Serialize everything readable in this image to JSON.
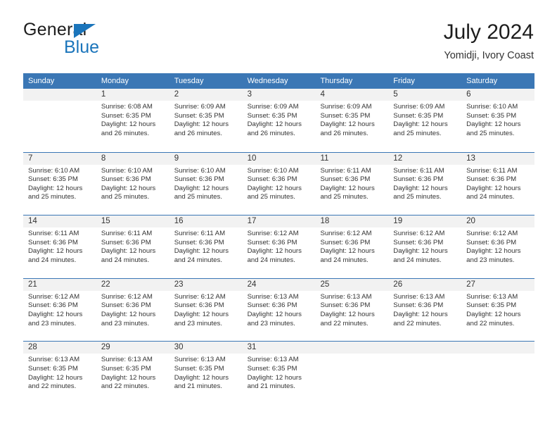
{
  "brand": {
    "word_one": "General",
    "word_two": "Blue",
    "flag_icon": "triangle-flag-icon",
    "accent_color": "#1b75bb"
  },
  "header": {
    "title": "July 2024",
    "subtitle": "Yomidji, Ivory Coast"
  },
  "calendar": {
    "header_color": "#3b77b5",
    "day_band_color": "#f2f2f2",
    "day_names": [
      "Sunday",
      "Monday",
      "Tuesday",
      "Wednesday",
      "Thursday",
      "Friday",
      "Saturday"
    ],
    "weeks": [
      [
        {
          "day": "",
          "lines": []
        },
        {
          "day": "1",
          "lines": [
            "Sunrise: 6:08 AM",
            "Sunset: 6:35 PM",
            "Daylight: 12 hours",
            "and 26 minutes."
          ]
        },
        {
          "day": "2",
          "lines": [
            "Sunrise: 6:09 AM",
            "Sunset: 6:35 PM",
            "Daylight: 12 hours",
            "and 26 minutes."
          ]
        },
        {
          "day": "3",
          "lines": [
            "Sunrise: 6:09 AM",
            "Sunset: 6:35 PM",
            "Daylight: 12 hours",
            "and 26 minutes."
          ]
        },
        {
          "day": "4",
          "lines": [
            "Sunrise: 6:09 AM",
            "Sunset: 6:35 PM",
            "Daylight: 12 hours",
            "and 26 minutes."
          ]
        },
        {
          "day": "5",
          "lines": [
            "Sunrise: 6:09 AM",
            "Sunset: 6:35 PM",
            "Daylight: 12 hours",
            "and 25 minutes."
          ]
        },
        {
          "day": "6",
          "lines": [
            "Sunrise: 6:10 AM",
            "Sunset: 6:35 PM",
            "Daylight: 12 hours",
            "and 25 minutes."
          ]
        }
      ],
      [
        {
          "day": "7",
          "lines": [
            "Sunrise: 6:10 AM",
            "Sunset: 6:35 PM",
            "Daylight: 12 hours",
            "and 25 minutes."
          ]
        },
        {
          "day": "8",
          "lines": [
            "Sunrise: 6:10 AM",
            "Sunset: 6:36 PM",
            "Daylight: 12 hours",
            "and 25 minutes."
          ]
        },
        {
          "day": "9",
          "lines": [
            "Sunrise: 6:10 AM",
            "Sunset: 6:36 PM",
            "Daylight: 12 hours",
            "and 25 minutes."
          ]
        },
        {
          "day": "10",
          "lines": [
            "Sunrise: 6:10 AM",
            "Sunset: 6:36 PM",
            "Daylight: 12 hours",
            "and 25 minutes."
          ]
        },
        {
          "day": "11",
          "lines": [
            "Sunrise: 6:11 AM",
            "Sunset: 6:36 PM",
            "Daylight: 12 hours",
            "and 25 minutes."
          ]
        },
        {
          "day": "12",
          "lines": [
            "Sunrise: 6:11 AM",
            "Sunset: 6:36 PM",
            "Daylight: 12 hours",
            "and 25 minutes."
          ]
        },
        {
          "day": "13",
          "lines": [
            "Sunrise: 6:11 AM",
            "Sunset: 6:36 PM",
            "Daylight: 12 hours",
            "and 24 minutes."
          ]
        }
      ],
      [
        {
          "day": "14",
          "lines": [
            "Sunrise: 6:11 AM",
            "Sunset: 6:36 PM",
            "Daylight: 12 hours",
            "and 24 minutes."
          ]
        },
        {
          "day": "15",
          "lines": [
            "Sunrise: 6:11 AM",
            "Sunset: 6:36 PM",
            "Daylight: 12 hours",
            "and 24 minutes."
          ]
        },
        {
          "day": "16",
          "lines": [
            "Sunrise: 6:11 AM",
            "Sunset: 6:36 PM",
            "Daylight: 12 hours",
            "and 24 minutes."
          ]
        },
        {
          "day": "17",
          "lines": [
            "Sunrise: 6:12 AM",
            "Sunset: 6:36 PM",
            "Daylight: 12 hours",
            "and 24 minutes."
          ]
        },
        {
          "day": "18",
          "lines": [
            "Sunrise: 6:12 AM",
            "Sunset: 6:36 PM",
            "Daylight: 12 hours",
            "and 24 minutes."
          ]
        },
        {
          "day": "19",
          "lines": [
            "Sunrise: 6:12 AM",
            "Sunset: 6:36 PM",
            "Daylight: 12 hours",
            "and 24 minutes."
          ]
        },
        {
          "day": "20",
          "lines": [
            "Sunrise: 6:12 AM",
            "Sunset: 6:36 PM",
            "Daylight: 12 hours",
            "and 23 minutes."
          ]
        }
      ],
      [
        {
          "day": "21",
          "lines": [
            "Sunrise: 6:12 AM",
            "Sunset: 6:36 PM",
            "Daylight: 12 hours",
            "and 23 minutes."
          ]
        },
        {
          "day": "22",
          "lines": [
            "Sunrise: 6:12 AM",
            "Sunset: 6:36 PM",
            "Daylight: 12 hours",
            "and 23 minutes."
          ]
        },
        {
          "day": "23",
          "lines": [
            "Sunrise: 6:12 AM",
            "Sunset: 6:36 PM",
            "Daylight: 12 hours",
            "and 23 minutes."
          ]
        },
        {
          "day": "24",
          "lines": [
            "Sunrise: 6:13 AM",
            "Sunset: 6:36 PM",
            "Daylight: 12 hours",
            "and 23 minutes."
          ]
        },
        {
          "day": "25",
          "lines": [
            "Sunrise: 6:13 AM",
            "Sunset: 6:36 PM",
            "Daylight: 12 hours",
            "and 22 minutes."
          ]
        },
        {
          "day": "26",
          "lines": [
            "Sunrise: 6:13 AM",
            "Sunset: 6:36 PM",
            "Daylight: 12 hours",
            "and 22 minutes."
          ]
        },
        {
          "day": "27",
          "lines": [
            "Sunrise: 6:13 AM",
            "Sunset: 6:35 PM",
            "Daylight: 12 hours",
            "and 22 minutes."
          ]
        }
      ],
      [
        {
          "day": "28",
          "lines": [
            "Sunrise: 6:13 AM",
            "Sunset: 6:35 PM",
            "Daylight: 12 hours",
            "and 22 minutes."
          ]
        },
        {
          "day": "29",
          "lines": [
            "Sunrise: 6:13 AM",
            "Sunset: 6:35 PM",
            "Daylight: 12 hours",
            "and 22 minutes."
          ]
        },
        {
          "day": "30",
          "lines": [
            "Sunrise: 6:13 AM",
            "Sunset: 6:35 PM",
            "Daylight: 12 hours",
            "and 21 minutes."
          ]
        },
        {
          "day": "31",
          "lines": [
            "Sunrise: 6:13 AM",
            "Sunset: 6:35 PM",
            "Daylight: 12 hours",
            "and 21 minutes."
          ]
        },
        {
          "day": "",
          "lines": []
        },
        {
          "day": "",
          "lines": []
        },
        {
          "day": "",
          "lines": []
        }
      ]
    ]
  }
}
